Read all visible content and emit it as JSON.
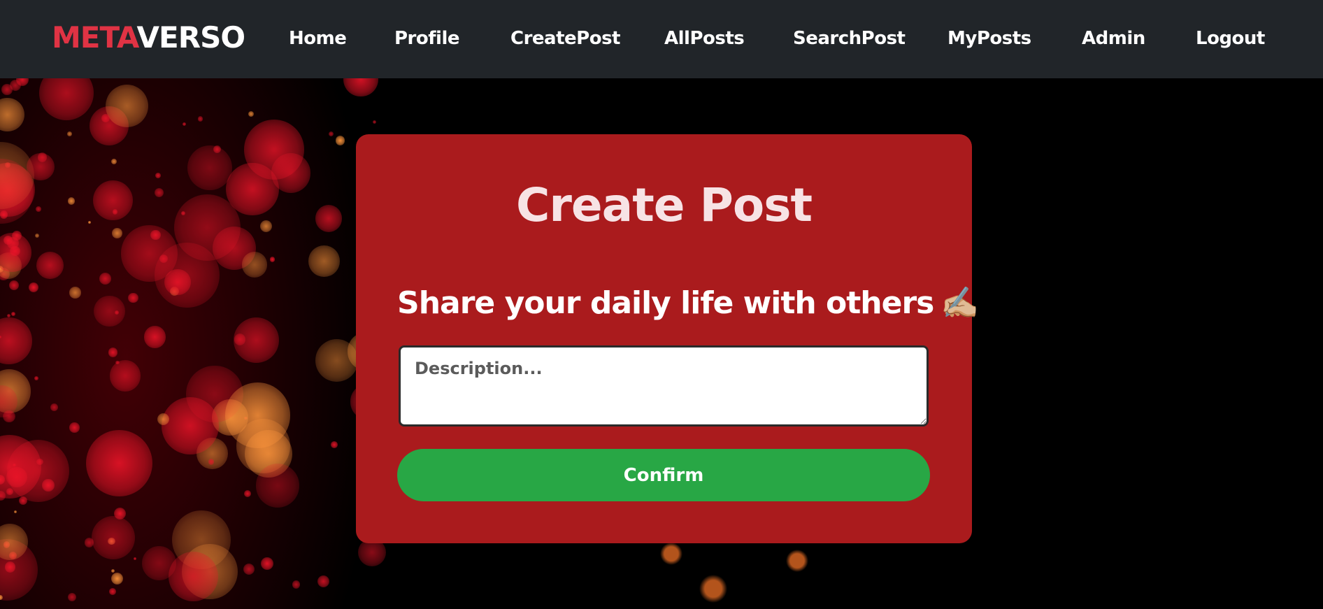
{
  "navbar": {
    "brand_part1": "META",
    "brand_part2": "VERSO",
    "items": [
      {
        "label": "Home"
      },
      {
        "label": "Profile"
      },
      {
        "label": "CreatePost"
      },
      {
        "label": "AllPosts"
      },
      {
        "label": "SearchPost"
      },
      {
        "label": "MyPosts"
      },
      {
        "label": "Admin"
      },
      {
        "label": "Logout"
      }
    ]
  },
  "card": {
    "title": "Create Post",
    "subtitle": "Share your daily life with others",
    "subtitle_icon": "✍🏼",
    "description_placeholder": "Description...",
    "description_value": "",
    "confirm_label": "Confirm"
  },
  "colors": {
    "navbar_bg": "#212529",
    "brand_accent": "#e03344",
    "card_bg": "#aa1b1d",
    "confirm_bg": "#28a745",
    "page_bg": "#000000"
  }
}
